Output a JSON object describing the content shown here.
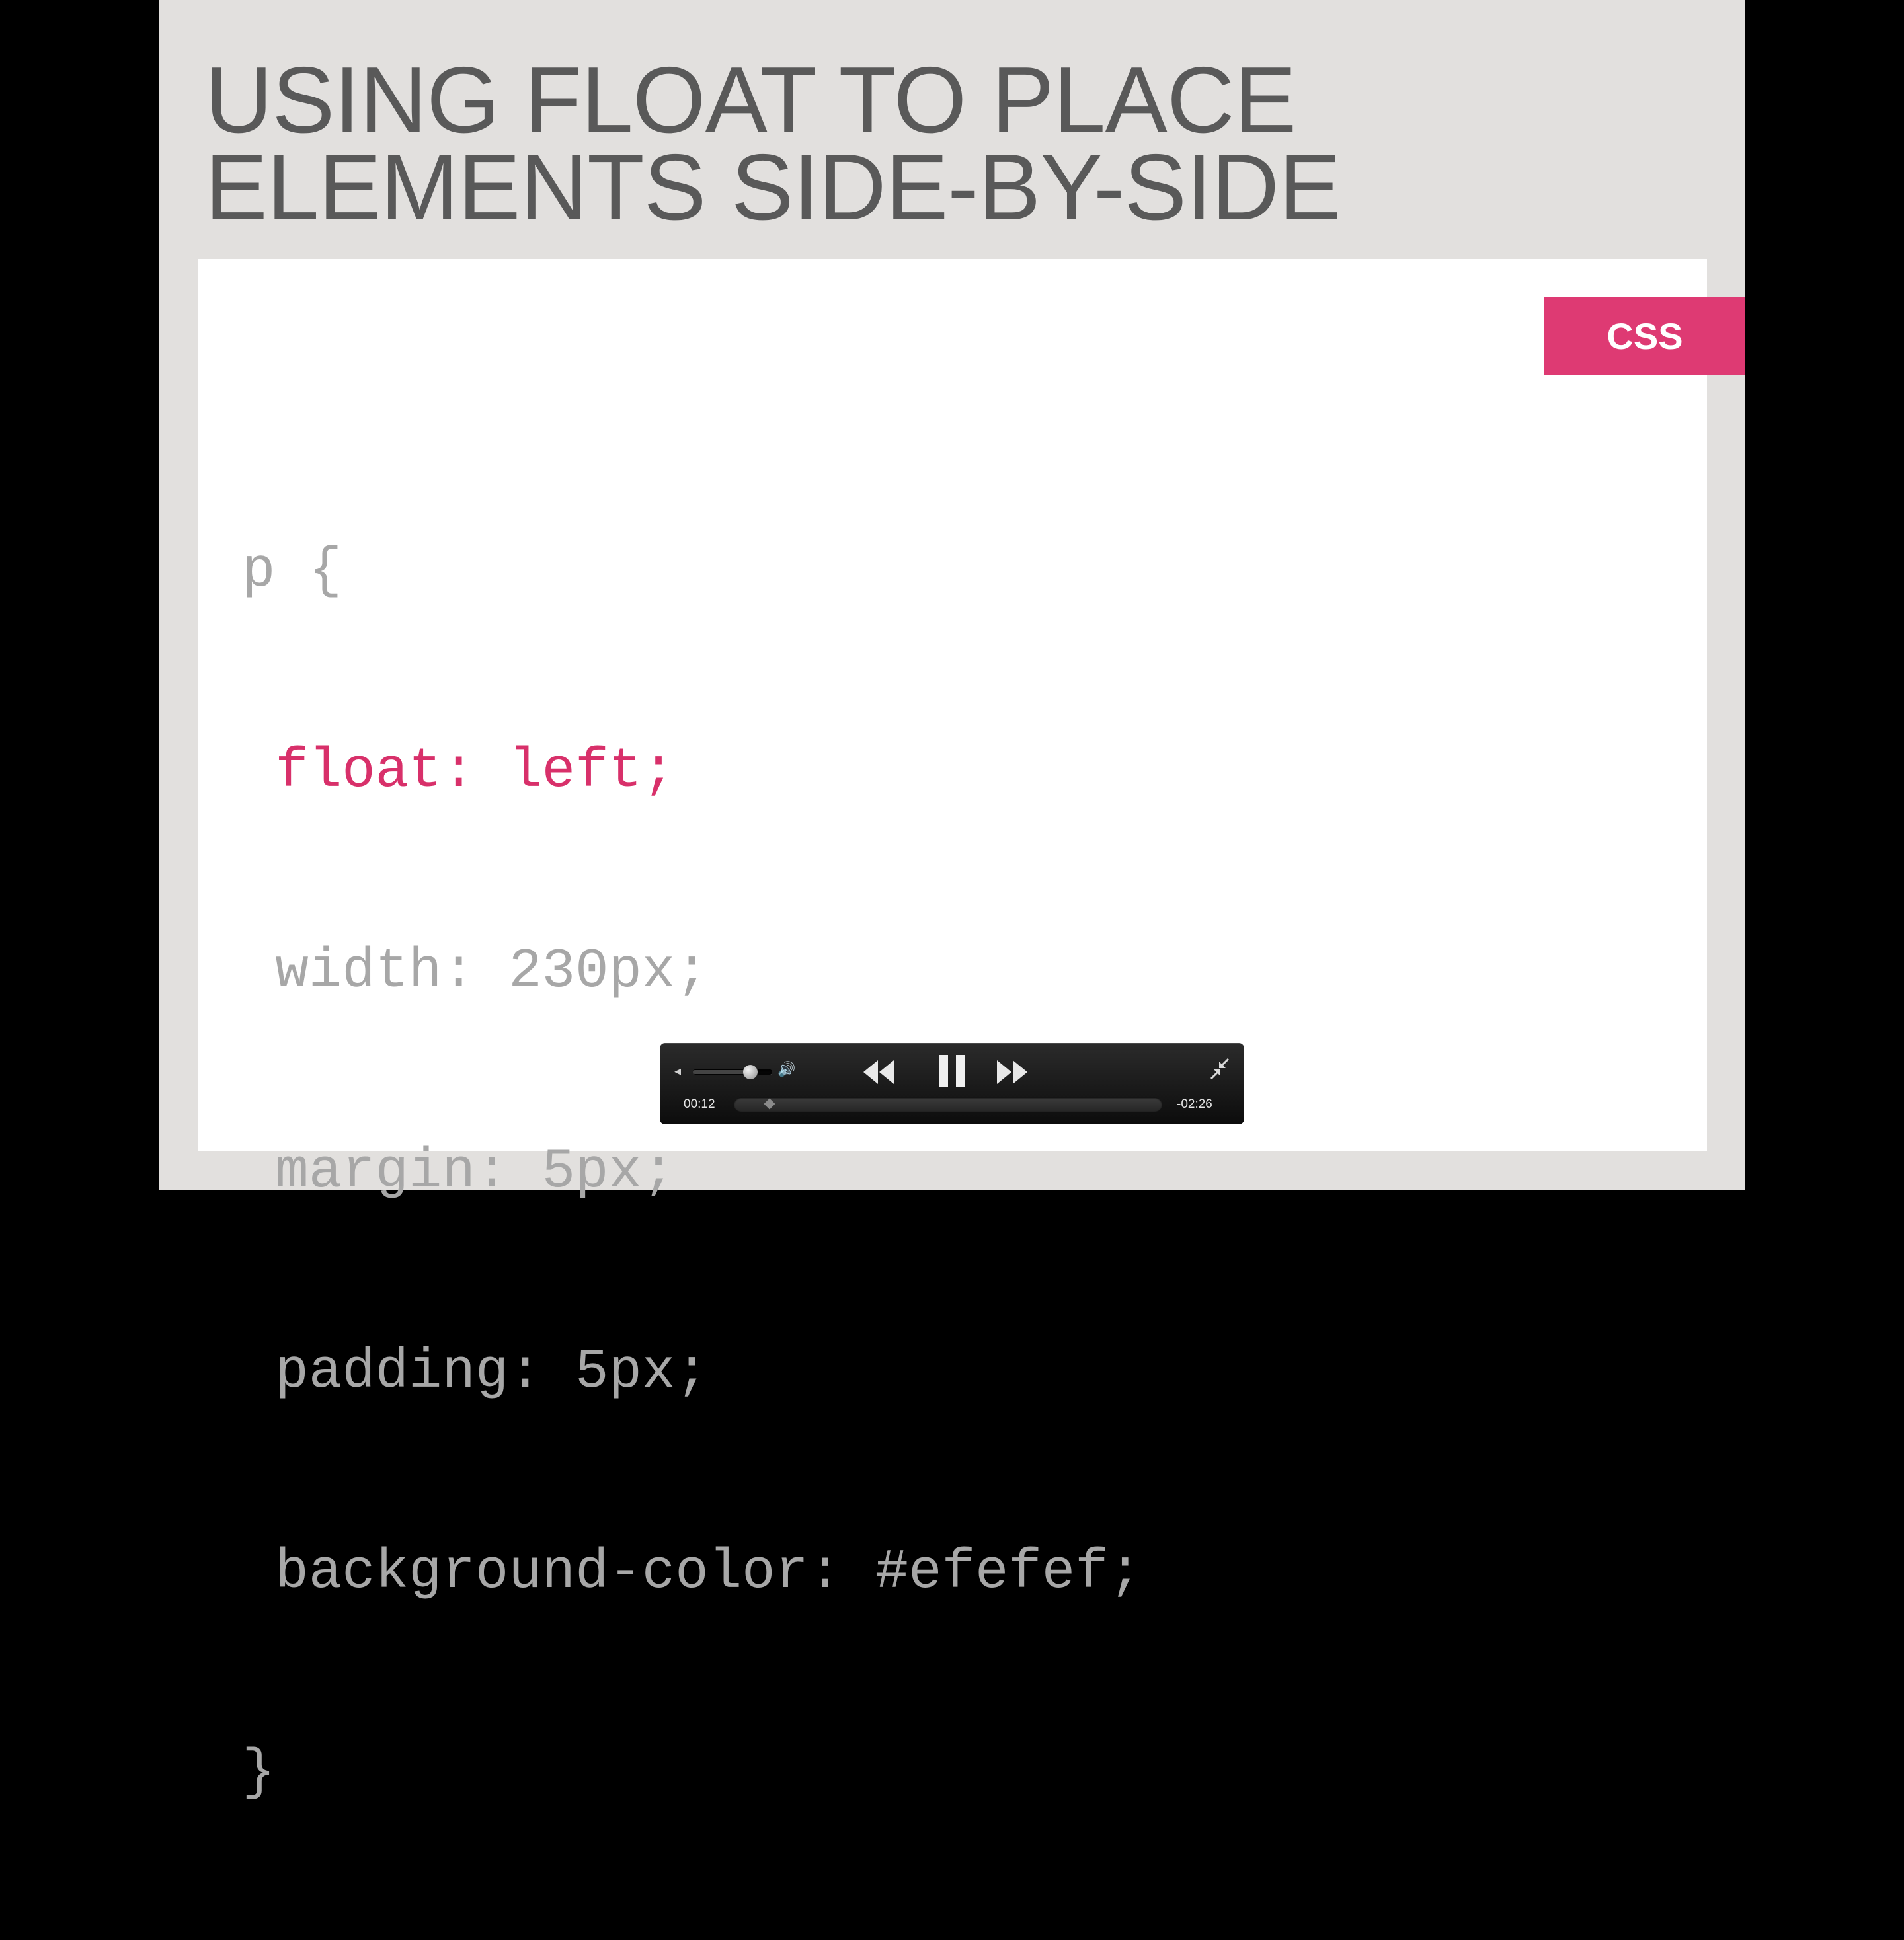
{
  "slide": {
    "title_lines": [
      "USING FLOAT TO PLACE",
      "ELEMENTS SIDE-BY-SIDE"
    ],
    "tag": "CSS",
    "code": {
      "open": "p {",
      "highlighted": " float: left;",
      "lines": [
        " width: 230px;",
        " margin: 5px;",
        " padding: 5px;",
        " background-color: #efefef;"
      ],
      "close": "}"
    },
    "colors": {
      "background": "#e2e0de",
      "panel": "#ffffff",
      "accent": "#de3a73",
      "code_text": "#a7a7a7",
      "title_text": "#595959"
    }
  },
  "player": {
    "current_time": "00:12",
    "remaining_time": "-02:26",
    "progress": 0.08,
    "volume": 0.72,
    "state": "playing",
    "icons": {
      "volume_low": "volume-low-icon",
      "volume_high": "volume-high-icon",
      "rewind": "rewind-icon",
      "pause": "pause-icon",
      "fast_forward": "fast-forward-icon",
      "exit_fullscreen": "exit-fullscreen-icon"
    }
  }
}
